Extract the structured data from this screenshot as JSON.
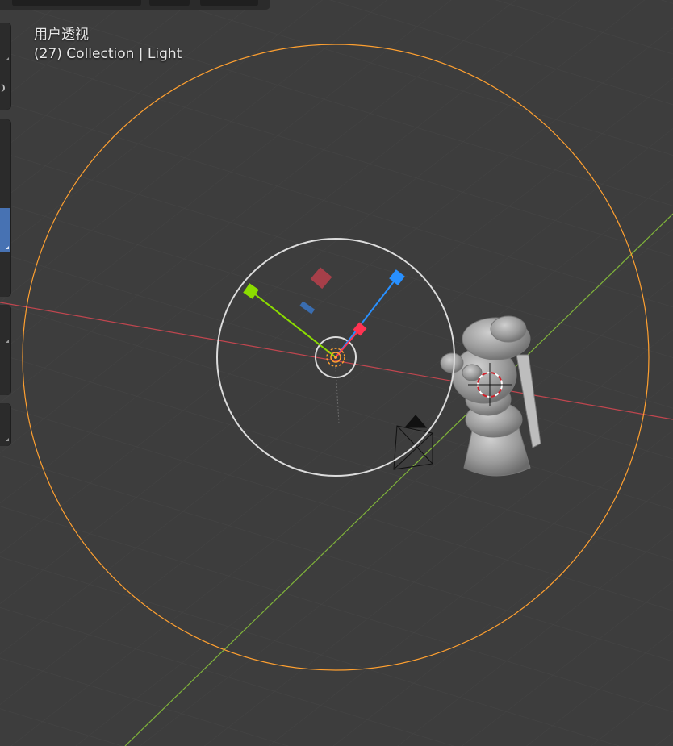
{
  "viewport": {
    "view_name": "用户透视",
    "object_info": "(27) Collection | Light"
  },
  "colors": {
    "background": "#3d3d3d",
    "x_axis": "#c0464f",
    "y_axis": "#7fb33a",
    "selection_outline": "#ffa030",
    "gizmo_white": "#dcdcdc",
    "gizmo_x": "#ff3352",
    "gizmo_y": "#8bdc00",
    "gizmo_z": "#2890ff",
    "toolbar_active": "#4772b3"
  },
  "icons": {
    "light": "light-icon",
    "camera": "camera-icon",
    "cursor": "3d-cursor-icon",
    "mesh": "sculpture-mesh"
  }
}
